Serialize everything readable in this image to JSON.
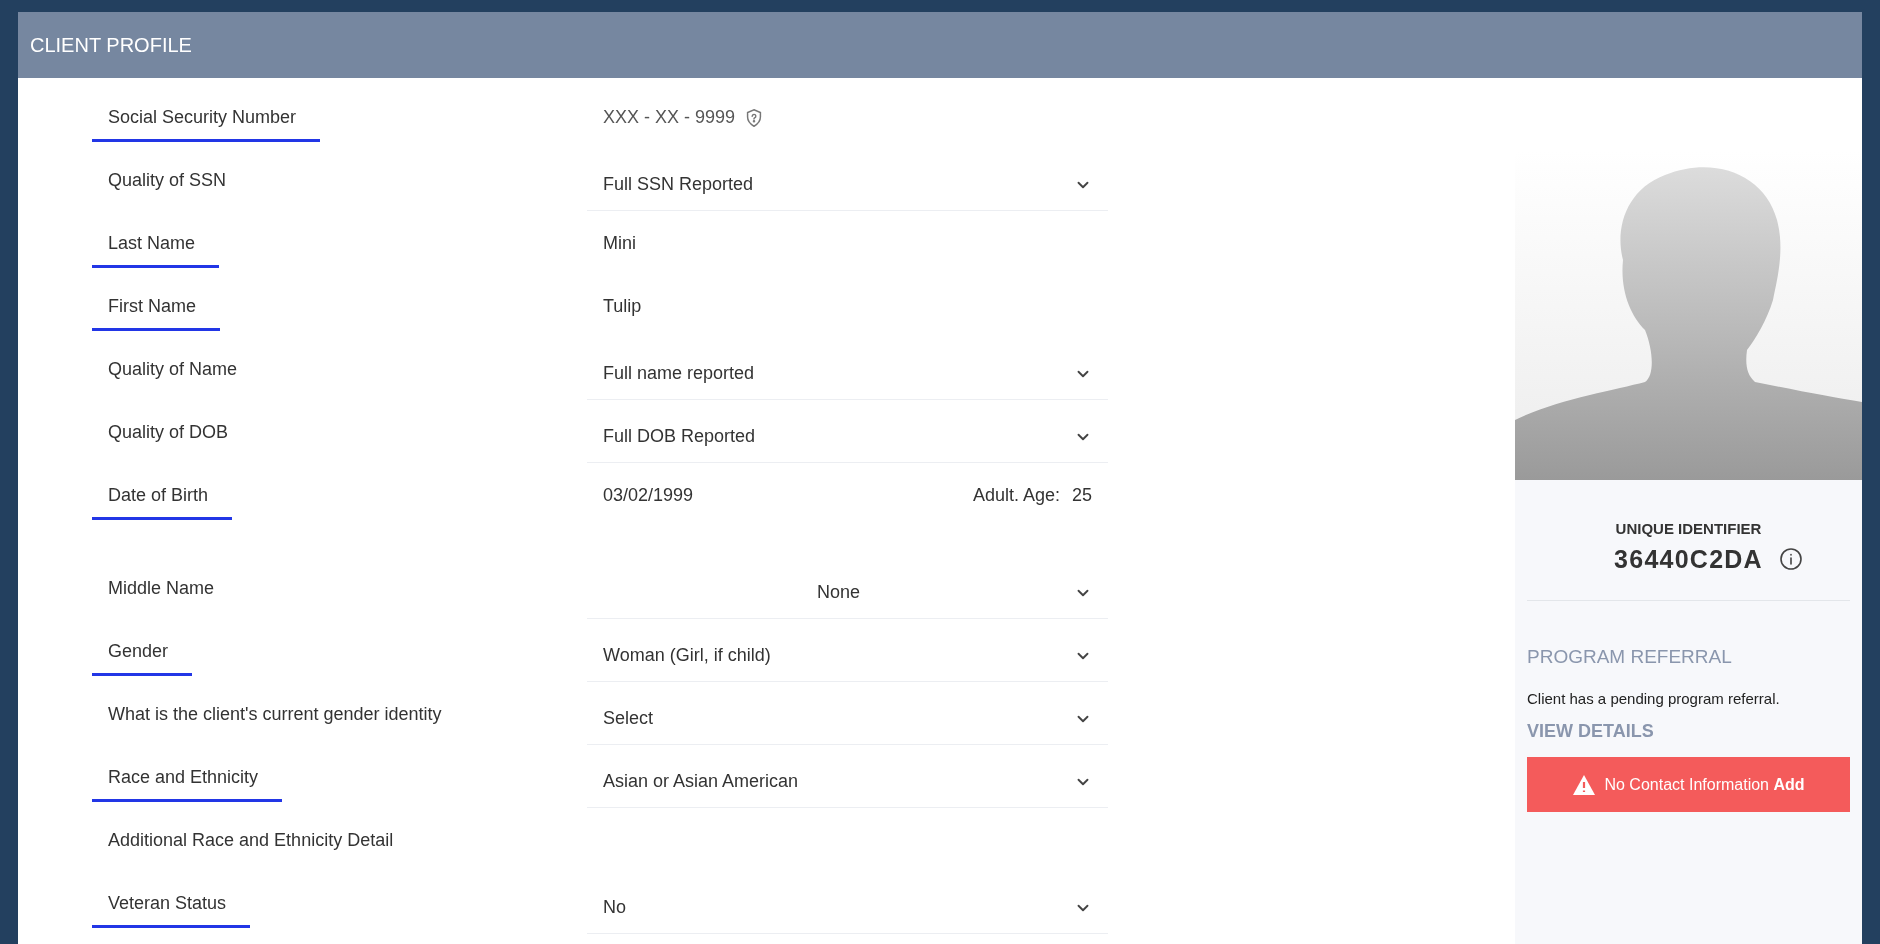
{
  "header": {
    "title": "CLIENT PROFILE"
  },
  "fields": [
    {
      "label": "Social Security Number",
      "underlined": true,
      "kind": "ssn",
      "value": "XXX - XX - 9999"
    },
    {
      "label": "Quality of SSN",
      "underlined": false,
      "kind": "select",
      "value": "Full SSN Reported"
    },
    {
      "label": "Last Name",
      "underlined": true,
      "kind": "text",
      "value": "Mini"
    },
    {
      "label": "First Name",
      "underlined": true,
      "kind": "text",
      "value": "Tulip"
    },
    {
      "label": "Quality of Name",
      "underlined": false,
      "kind": "select",
      "value": "Full name reported"
    },
    {
      "label": "Quality of DOB",
      "underlined": false,
      "kind": "select",
      "value": "Full DOB Reported"
    },
    {
      "label": "Date of Birth",
      "underlined": true,
      "kind": "dob",
      "value": "03/02/1999",
      "age_label": "Adult. Age:",
      "age": "25"
    },
    {
      "label": "Middle Name",
      "underlined": false,
      "kind": "centered-select",
      "value": "None"
    },
    {
      "label": "Gender",
      "underlined": true,
      "kind": "select",
      "value": "Woman (Girl, if child)"
    },
    {
      "label": "What is the client's current gender identity",
      "underlined": false,
      "kind": "select",
      "value": "Select"
    },
    {
      "label": "Race and Ethnicity",
      "underlined": true,
      "kind": "select",
      "value": "Asian or Asian American"
    },
    {
      "label": "Additional Race and Ethnicity Detail",
      "underlined": false,
      "kind": "label"
    },
    {
      "label": "Veteran Status",
      "underlined": true,
      "kind": "select",
      "value": "No"
    }
  ],
  "profile": {
    "identifier_label": "UNIQUE IDENTIFIER",
    "identifier": "36440C2DA",
    "referral_heading": "PROGRAM REFERRAL",
    "referral_text": "Client has a pending program referral.",
    "referral_link": "VIEW DETAILS",
    "alert_text": "No Contact Information",
    "alert_action": "Add"
  }
}
